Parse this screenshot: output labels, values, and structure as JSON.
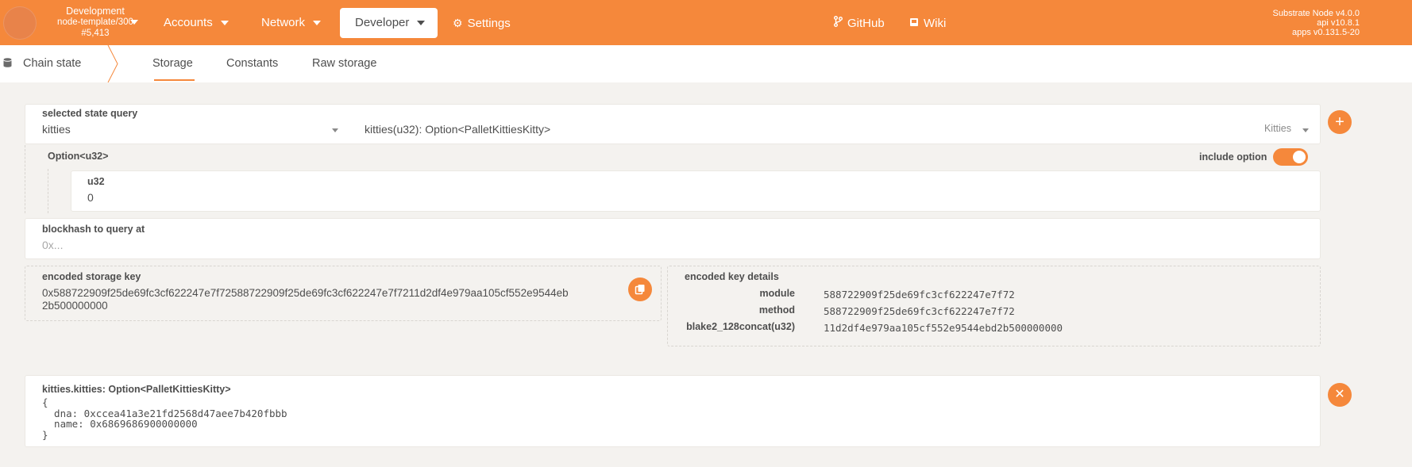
{
  "topbar": {
    "chain": {
      "name": "Development",
      "runtime": "node-template/300",
      "block": "#5,413"
    },
    "nav": [
      {
        "label": "Accounts"
      },
      {
        "label": "Network"
      },
      {
        "label": "Developer"
      },
      {
        "label": "Settings"
      }
    ],
    "links": [
      {
        "label": "GitHub"
      },
      {
        "label": "Wiki"
      }
    ],
    "node": {
      "name": "Substrate Node v4.0.0",
      "api": "api v10.8.1",
      "apps": "apps v0.131.5-20"
    }
  },
  "subnav": {
    "section": "Chain state",
    "tabs": [
      {
        "label": "Storage"
      },
      {
        "label": "Constants"
      },
      {
        "label": "Raw storage"
      }
    ]
  },
  "query": {
    "label": "selected state query",
    "module": "kitties",
    "method": "kitties(u32): Option<PalletKittiesKitty>",
    "section": "Kitties",
    "add_icon": "plus-icon"
  },
  "option": {
    "label": "Option<u32>",
    "include_label": "include option",
    "include_on": true,
    "param_label": "u32",
    "param_value": "0"
  },
  "blockhash": {
    "label": "blockhash to query at",
    "placeholder": "0x..."
  },
  "encoded": {
    "label": "encoded storage key",
    "line1": "0x588722909f25de69fc3cf622247e7f72588722909f25de69fc3cf622247e7f7211d2df4e979aa105cf552e9544eb",
    "line2": "2b500000000",
    "copy_icon": "copy-icon"
  },
  "details": {
    "label": "encoded key details",
    "rows": [
      {
        "key": "module",
        "value": "588722909f25de69fc3cf622247e7f72"
      },
      {
        "key": "method",
        "value": "588722909f25de69fc3cf622247e7f72"
      },
      {
        "key": "blake2_128concat(u32)",
        "value": "11d2df4e979aa105cf552e9544ebd2b500000000"
      }
    ]
  },
  "result": {
    "label": "kitties.kitties: Option<PalletKittiesKitty>",
    "lines": [
      "{",
      "  dna: 0xccea41a3e21fd2568d47aee7b420fbbb",
      "  name: 0x6869686900000000",
      "}"
    ],
    "close_icon": "close-icon"
  },
  "colors": {
    "accent": "#f5883b",
    "background": "#f4f2ef"
  }
}
